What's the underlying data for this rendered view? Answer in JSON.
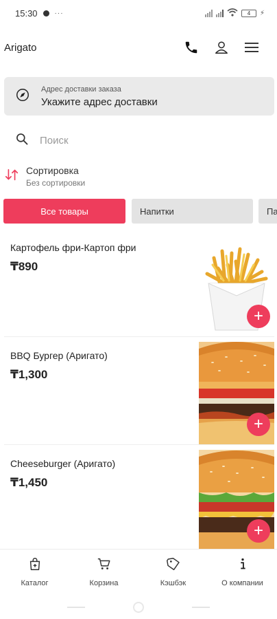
{
  "status_bar": {
    "time": "15:30",
    "dots": "···",
    "battery": "4"
  },
  "header": {
    "title": "Arigato",
    "icons": [
      "phone-icon",
      "user-icon",
      "menu-icon"
    ]
  },
  "address": {
    "label": "Адрес доставки заказа",
    "value": "Укажите адрес доставки"
  },
  "search": {
    "placeholder": "Поиск",
    "value": ""
  },
  "sort": {
    "title": "Сортировка",
    "subtitle": "Без сортировки"
  },
  "tabs": [
    {
      "label": "Все товары",
      "active": true
    },
    {
      "label": "Напитки",
      "active": false
    },
    {
      "label": "Па",
      "active": false
    }
  ],
  "products": [
    {
      "name": "Картофель фри-Картоп фри",
      "price": "₸890",
      "image": "fries"
    },
    {
      "name": "BBQ Бургер (Аригато)",
      "price": "₸1,300",
      "image": "burger"
    },
    {
      "name": "Cheeseburger (Аригато)",
      "price": "₸1,450",
      "image": "cheeseburger"
    }
  ],
  "bottom_nav": [
    {
      "label": "Каталог",
      "icon": "bag-icon"
    },
    {
      "label": "Корзина",
      "icon": "cart-icon"
    },
    {
      "label": "Кэшбэк",
      "icon": "tag-icon"
    },
    {
      "label": "О компании",
      "icon": "info-icon"
    }
  ],
  "colors": {
    "accent": "#ee3d5c",
    "address_bg": "#eaeaea",
    "inactive_tab": "#e3e3e3"
  }
}
